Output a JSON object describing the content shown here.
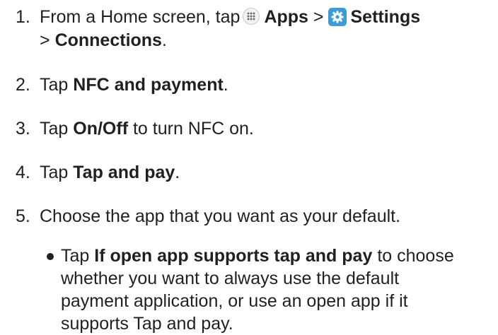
{
  "steps": [
    {
      "num": "1.",
      "pre": "From a Home screen, tap",
      "apps": "Apps",
      "sep1": ">",
      "settings": "Settings",
      "sep2": ">",
      "connections": "Connections",
      "end": "."
    },
    {
      "num": "2.",
      "pre": "Tap",
      "bold": "NFC and payment",
      "post": "."
    },
    {
      "num": "3.",
      "pre": "Tap",
      "bold": "On/Off",
      "post": "to turn NFC on."
    },
    {
      "num": "4.",
      "pre": "Tap",
      "bold": "Tap and pay",
      "post": "."
    },
    {
      "num": "5.",
      "text": "Choose the app that you want as your default."
    }
  ],
  "bullet": {
    "pre": "Tap",
    "bold": "If open app supports tap and pay",
    "post": "to choose whether you want to always use the default payment application, or use an open app if it supports Tap and pay."
  },
  "icons": {
    "apps": "apps-grid-icon",
    "settings": "settings-gear-icon",
    "settings_color": "#3d9bd6"
  }
}
